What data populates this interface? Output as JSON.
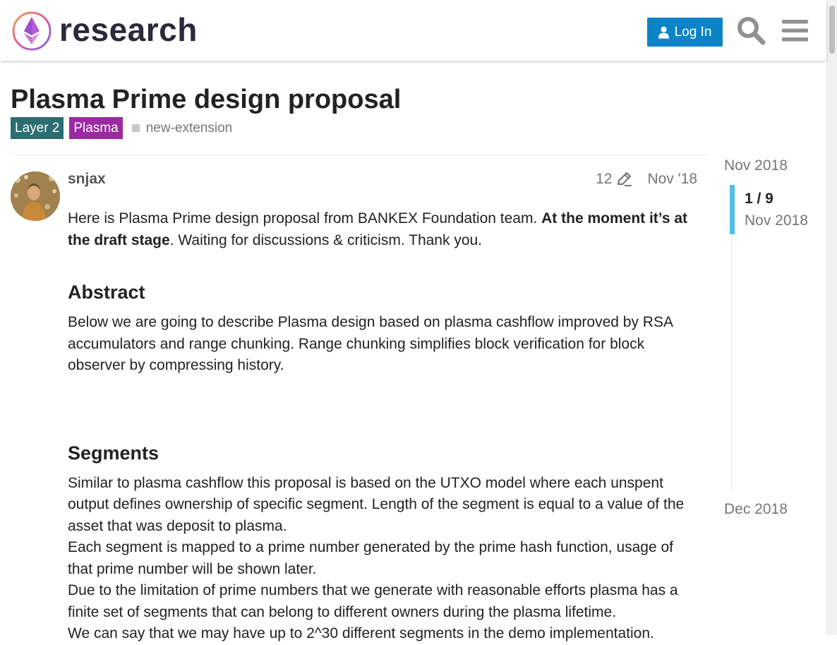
{
  "header": {
    "site_name": "research",
    "login_label": "Log In"
  },
  "topic": {
    "title": "Plasma Prime design proposal",
    "categories": [
      {
        "label": "Layer 2",
        "color": "#2b6d70"
      },
      {
        "label": "Plasma",
        "color": "#9a2aa1"
      }
    ],
    "tags": [
      "new-extension"
    ]
  },
  "post": {
    "username": "snjax",
    "edit_count": "12",
    "date": "Nov '18",
    "intro_plain": "Here is Plasma Prime design proposal from BANKEX Foundation team. ",
    "intro_bold": "At the moment it’s at the draft stage",
    "intro_tail": ". Waiting for discussions & criticism. Thank you.",
    "abstract_heading": "Abstract",
    "abstract_text": "Below we are going to describe Plasma design based on plasma cashflow improved by RSA accumulators and range chunking. Range chunking simplifies block verification for block observer by compressing history.",
    "segments_heading": "Segments",
    "segments_p1": "Similar to plasma cashflow this proposal is based on the UTXO model where each unspent output defines ownership of specific segment. Length of the segment is equal to a value of the asset that was deposit to plasma.",
    "segments_p2": "Each segment is mapped to a prime number generated by the prime hash function, usage of that prime number will be shown later.",
    "segments_p3": "Due to the limitation of prime numbers that we generate with reasonable efforts plasma has a finite set of segments that can belong to different owners during the plasma lifetime.",
    "segments_p4": "We can say that we may have up to 2^30 different segments in the demo implementation."
  },
  "timeline": {
    "start": "Nov 2018",
    "position": "1 / 9",
    "position_date": "Nov 2018",
    "end": "Dec 2018"
  },
  "colors": {
    "accent": "#0a84c7",
    "timeline_handle": "#4fc1e9"
  }
}
